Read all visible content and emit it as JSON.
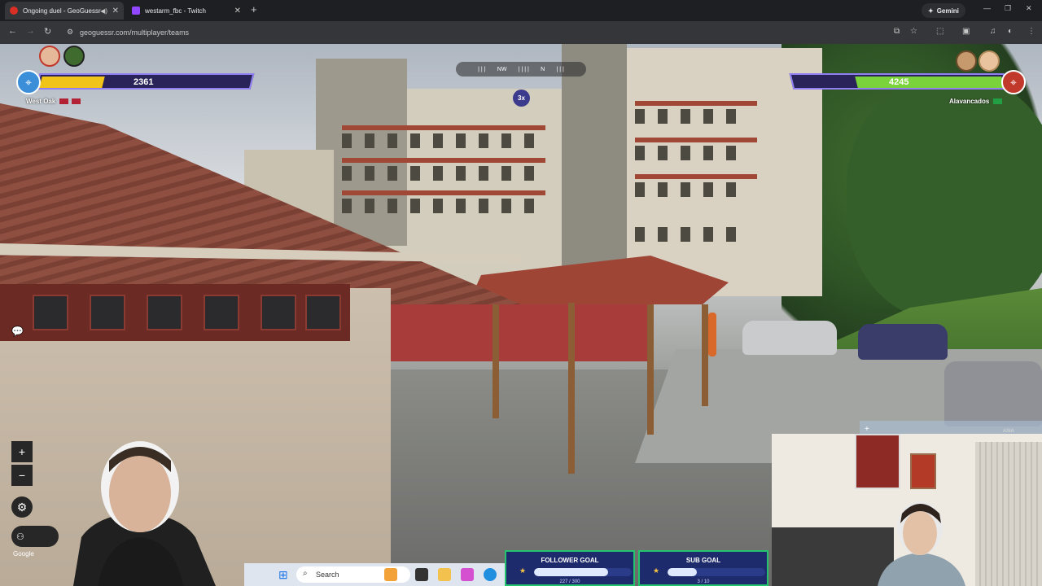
{
  "browser": {
    "tabs": [
      {
        "title": "Ongoing duel - GeoGuessr",
        "active": true
      },
      {
        "title": "westarm_fbc - Twitch",
        "active": false
      }
    ],
    "gemini_label": "Gemini",
    "url": "geoguessr.com/multiplayer/teams"
  },
  "game": {
    "left_team": {
      "score": "2361",
      "name": "West Oak",
      "flag_color": "#b22234",
      "health_fraction": 0.3
    },
    "right_team": {
      "score": "4245",
      "name": "Alavancados",
      "flag_color": "#229e45",
      "health_fraction": 0.75
    },
    "compass": {
      "marks": [
        "NW",
        "N"
      ]
    },
    "multiplier": "3x",
    "zoom_in": "+",
    "zoom_out": "−",
    "attribution": "Google",
    "minimap_label": "ASIA"
  },
  "taskbar": {
    "search_placeholder": "Search"
  },
  "goals": [
    {
      "title": "FOLLOWER GOAL",
      "value_text": "227 / 300",
      "fraction": 0.757
    },
    {
      "title": "SUB GOAL",
      "value_text": "3 / 10",
      "fraction": 0.3
    }
  ],
  "colors": {
    "team_bar_left": "#f0c419",
    "team_bar_right": "#7ad33a",
    "hud_border": "#8f7ff0",
    "goal_border": "#23c46d"
  }
}
